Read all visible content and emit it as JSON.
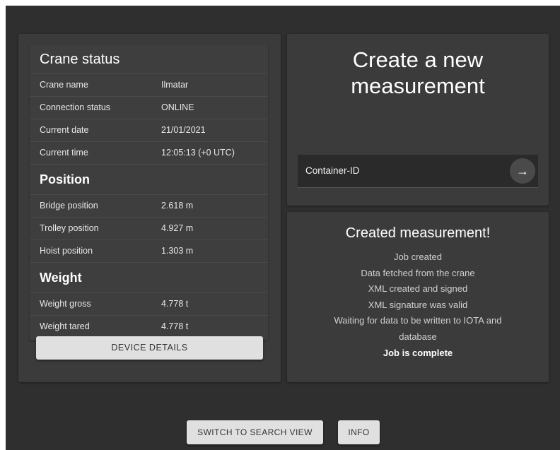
{
  "crane_status": {
    "title": "Crane status",
    "rows": [
      {
        "label": "Crane name",
        "value": "Ilmatar"
      },
      {
        "label": "Connection status",
        "value": "ONLINE"
      },
      {
        "label": "Current date",
        "value": "21/01/2021"
      },
      {
        "label": "Current time",
        "value": "12:05:13 (+0 UTC)"
      }
    ],
    "position_title": "Position",
    "position_rows": [
      {
        "label": "Bridge position",
        "value": "2.618 m"
      },
      {
        "label": "Trolley position",
        "value": "4.927 m"
      },
      {
        "label": "Hoist position",
        "value": "1.303 m"
      }
    ],
    "weight_title": "Weight",
    "weight_rows": [
      {
        "label": "Weight gross",
        "value": "4.778 t"
      },
      {
        "label": "Weight tared",
        "value": "4.778 t"
      }
    ],
    "device_details_label": "DEVICE DETAILS"
  },
  "create": {
    "title_line1": "Create a new",
    "title_line2": "measurement",
    "container_label": "Container-ID",
    "arrow_icon": "arrow-right-icon"
  },
  "result": {
    "title": "Created measurement!",
    "lines": [
      "Job created",
      "Data fetched from the crane",
      "XML created and signed",
      "XML signature was valid",
      "Waiting for data to be written to IOTA and",
      "database"
    ],
    "final_line": "Job is complete"
  },
  "footer": {
    "switch_label": "SWITCH TO SEARCH VIEW",
    "info_label": "INFO"
  }
}
